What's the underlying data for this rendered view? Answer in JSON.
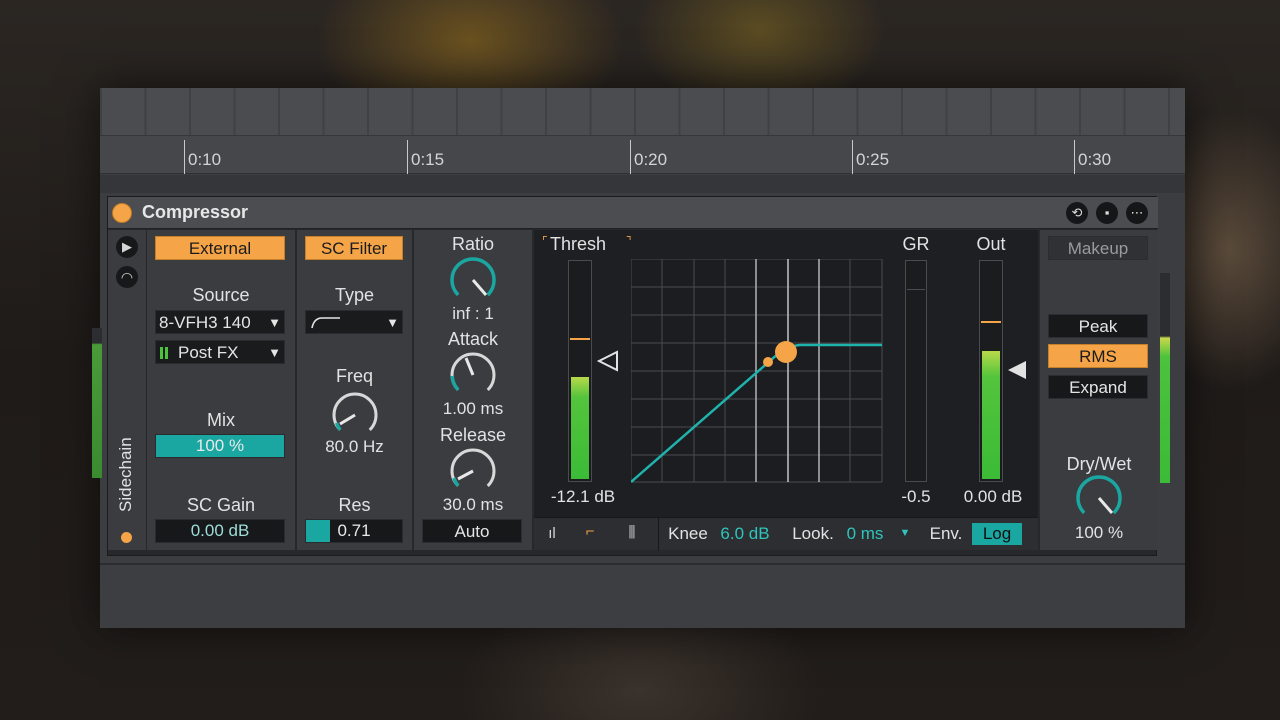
{
  "ruler": {
    "marks": [
      "0:10",
      "0:15",
      "0:20",
      "0:25",
      "0:30"
    ]
  },
  "device": {
    "title": "Compressor",
    "sidechain": {
      "vertical_label": "Sidechain",
      "external_label": "External",
      "source_label": "Source",
      "source_value": "8-VFH3 140",
      "tap_value": "Post FX",
      "mix_label": "Mix",
      "mix_value": "100 %",
      "mix_fraction": 1.0,
      "gain_label": "SC Gain",
      "gain_value": "0.00 dB"
    },
    "filter": {
      "button_label": "SC Filter",
      "type_label": "Type",
      "freq_label": "Freq",
      "freq_value": "80.0 Hz",
      "res_label": "Res",
      "res_value": "0.71",
      "res_fraction": 0.25
    },
    "compression": {
      "ratio_label": "Ratio",
      "ratio_value": "inf : 1",
      "attack_label": "Attack",
      "attack_value": "1.00 ms",
      "release_label": "Release",
      "release_value": "30.0 ms",
      "auto_label": "Auto"
    },
    "display": {
      "thresh_label": "Thresh",
      "thresh_value": "-12.1 dB",
      "gr_label": "GR",
      "gr_value": "-0.5",
      "out_label": "Out",
      "out_value": "0.00 dB",
      "knee_label": "Knee",
      "knee_value": "6.0 dB",
      "look_label": "Look.",
      "look_value": "0 ms",
      "env_label": "Env.",
      "env_value": "Log"
    },
    "right": {
      "makeup_label": "Makeup",
      "peak_label": "Peak",
      "rms_label": "RMS",
      "expand_label": "Expand",
      "drywet_label": "Dry/Wet",
      "drywet_value": "100 %"
    }
  },
  "colors": {
    "accent_orange": "#f5a447",
    "accent_teal": "#1aa6a1",
    "meter_green": "#3bbb37"
  }
}
